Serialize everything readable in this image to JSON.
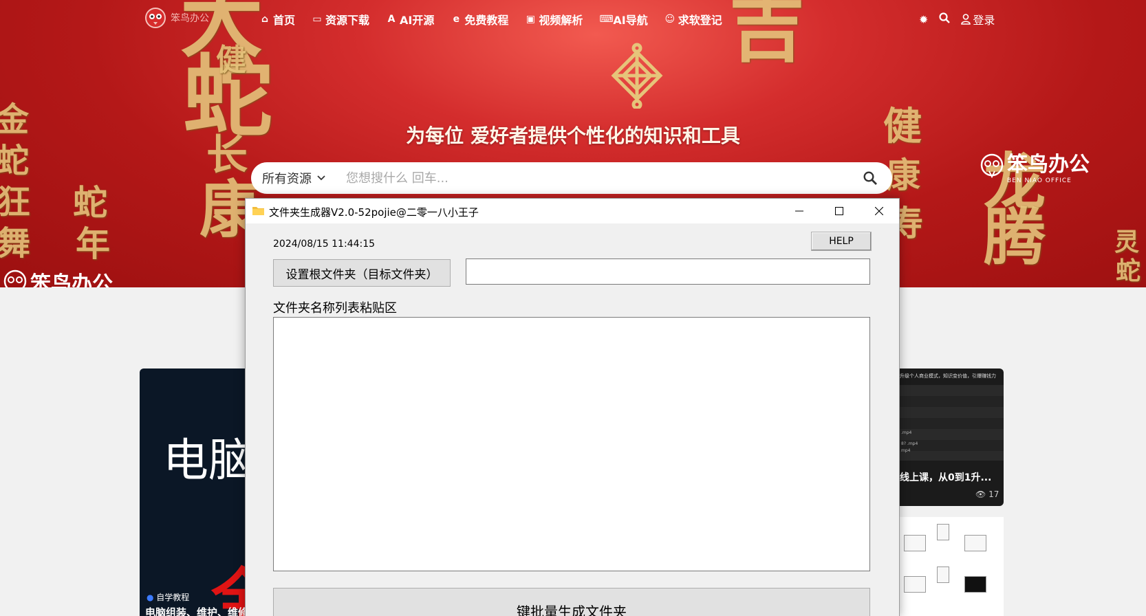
{
  "site": {
    "logo_text": "笨鸟办公",
    "nav": [
      {
        "icon": "home-icon",
        "glyph": "⌂",
        "label": "首页"
      },
      {
        "icon": "laptop-icon",
        "glyph": "▭",
        "label": "资源下载"
      },
      {
        "icon": "ai-icon",
        "glyph": "A",
        "label": "AI开源"
      },
      {
        "icon": "browser-icon",
        "glyph": "e",
        "label": "免费教程"
      },
      {
        "icon": "video-icon",
        "glyph": "▣",
        "label": "视频解析"
      },
      {
        "icon": "ai-nav-icon",
        "glyph": "⌨",
        "label": "AI导航"
      },
      {
        "icon": "smile-icon",
        "glyph": "☺",
        "label": "求软登记"
      }
    ],
    "login_label": "登录",
    "slogan": "为每位 爱好者提供个性化的知识和工具",
    "search": {
      "scope": "所有资源",
      "placeholder": "您想搜什么 回车..."
    },
    "watermark": {
      "text": "笨鸟办公",
      "sub": "BEN NIAO OFFICE"
    },
    "decor": {
      "c1": "大",
      "c2": "蛇",
      "c3": "健",
      "c4": "康",
      "c5": "长",
      "c6": "寿",
      "c7": "吉",
      "c8": "龙",
      "c9": "腾",
      "c10": "金",
      "c11": "蛇",
      "c12": "狂",
      "c13": "舞",
      "c14": "蛇",
      "c15": "年",
      "c16": "灵",
      "c17": "蛇"
    },
    "cards": {
      "left": {
        "big_text": "电脑",
        "red_text": "全",
        "category": "自学教程",
        "title": "电脑组装、维护、维修"
      },
      "right": {
        "header": "升级个人商业模式，知识变价值，引爆赚钱力",
        "title": "线上课，从0到1升...",
        "views": "17",
        "files": [
          ".mp4",
          "8? .mp4",
          "mp4"
        ]
      }
    }
  },
  "window": {
    "title": "文件夹生成器V2.0-52pojie@二零一八小王子",
    "datetime": "2024/08/15 11:44:15",
    "help_label": "HELP",
    "root_button": "设置根文件夹（目标文件夹）",
    "root_path_value": "",
    "paste_label": "文件夹名称列表粘贴区",
    "paste_value": "\n",
    "generate_label": "键批量生成文件夹"
  }
}
